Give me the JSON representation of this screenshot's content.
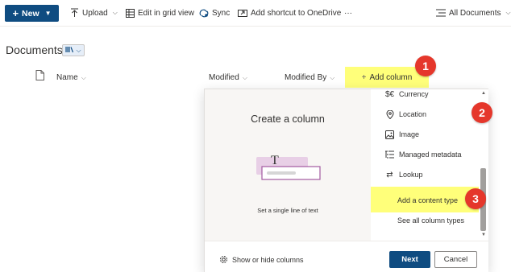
{
  "command_bar": {
    "new_label": "New",
    "upload_label": "Upload",
    "grid_label": "Edit in grid view",
    "sync_label": "Sync",
    "shortcut_label": "Add shortcut to OneDrive",
    "more_label": "···",
    "view_label": "All Documents"
  },
  "library": {
    "title": "Documents"
  },
  "columns": {
    "name": "Name",
    "modified": "Modified",
    "modified_by": "Modified By",
    "add_column": "Add column"
  },
  "annotations": {
    "one": "1",
    "two": "2",
    "three": "3"
  },
  "panel": {
    "title": "Create a column",
    "illustration_glyph": "T",
    "caption": "Set a single line of text",
    "types": [
      {
        "label": "Currency",
        "icon": "currency-icon"
      },
      {
        "label": "Location",
        "icon": "location-icon"
      },
      {
        "label": "Image",
        "icon": "image-icon"
      },
      {
        "label": "Managed metadata",
        "icon": "managed-metadata-icon"
      },
      {
        "label": "Lookup",
        "icon": "lookup-icon"
      }
    ],
    "content_type_label": "Add a content type",
    "see_all_label": "See all column types",
    "show_hide_label": "Show or hide columns",
    "next_label": "Next",
    "cancel_label": "Cancel"
  },
  "colors": {
    "brand": "#0f4c81",
    "highlight": "#ffff7a",
    "annotation": "#e5372b"
  }
}
